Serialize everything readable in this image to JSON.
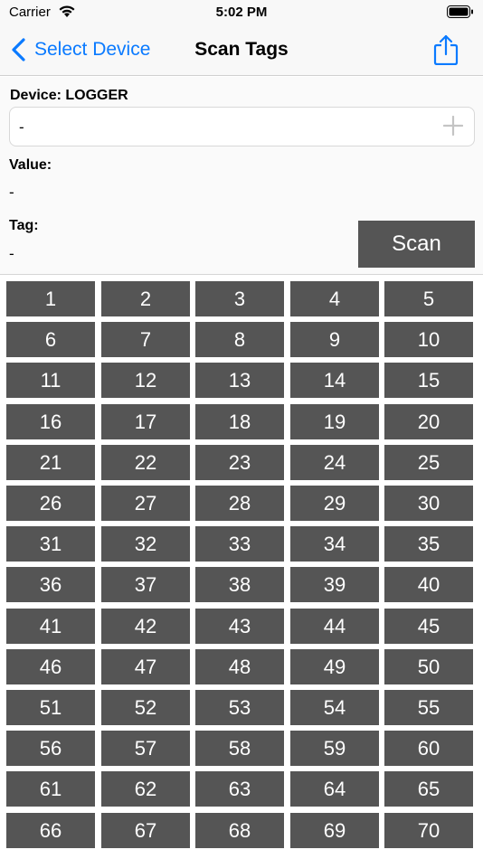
{
  "status_bar": {
    "carrier": "Carrier",
    "time": "5:02 PM",
    "wifi_icon": "wifi-icon",
    "battery_icon": "battery-icon"
  },
  "nav": {
    "back_label": "Select Device",
    "title": "Scan Tags",
    "share_icon": "share-icon",
    "accent_color": "#0a7aff"
  },
  "form": {
    "device_label": "Device: LOGGER",
    "device_value": "-",
    "add_icon": "plus-icon",
    "value_label": "Value:",
    "value_value": "-",
    "tag_label": "Tag:",
    "tag_value": "-",
    "scan_label": "Scan"
  },
  "tag_buttons": [
    "1",
    "2",
    "3",
    "4",
    "5",
    "6",
    "7",
    "8",
    "9",
    "10",
    "11",
    "12",
    "13",
    "14",
    "15",
    "16",
    "17",
    "18",
    "19",
    "20",
    "21",
    "22",
    "23",
    "24",
    "25",
    "26",
    "27",
    "28",
    "29",
    "30",
    "31",
    "32",
    "33",
    "34",
    "35",
    "36",
    "37",
    "38",
    "39",
    "40",
    "41",
    "42",
    "43",
    "44",
    "45",
    "46",
    "47",
    "48",
    "49",
    "50",
    "51",
    "52",
    "53",
    "54",
    "55",
    "56",
    "57",
    "58",
    "59",
    "60",
    "61",
    "62",
    "63",
    "64",
    "65",
    "66",
    "67",
    "68",
    "69",
    "70"
  ],
  "colors": {
    "button_bg": "#555555",
    "button_text": "#ffffff"
  }
}
